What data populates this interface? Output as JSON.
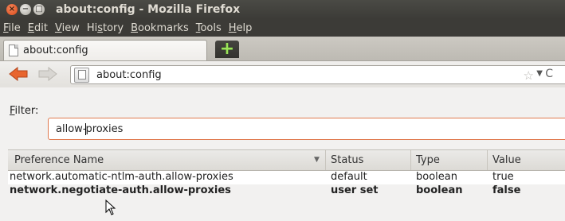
{
  "window": {
    "title": "about:config - Mozilla Firefox",
    "buttons": [
      "×",
      "−",
      "□"
    ]
  },
  "menubar": {
    "items": [
      {
        "mnemonic": "F",
        "rest": "ile"
      },
      {
        "mnemonic": "E",
        "rest": "dit"
      },
      {
        "mnemonic": "V",
        "rest": "iew"
      },
      {
        "pre": "Hi",
        "mnemonic": "s",
        "rest": "tory"
      },
      {
        "mnemonic": "B",
        "rest": "ookmarks"
      },
      {
        "mnemonic": "T",
        "rest": "ools"
      },
      {
        "mnemonic": "H",
        "rest": "elp"
      }
    ]
  },
  "tabs": [
    {
      "label": "about:config"
    }
  ],
  "newtab": {
    "label": "+"
  },
  "navbar": {
    "url": "about:config",
    "star": "☆",
    "dropdown": "▼",
    "reload": "C"
  },
  "filter": {
    "label_mnemonic": "F",
    "label_rest": "ilter:",
    "value_before_caret": "allow-",
    "value_after_caret": "proxies"
  },
  "table": {
    "columns": [
      "Preference Name",
      "Status",
      "Type",
      "Value"
    ],
    "sort_icon": "▼",
    "rows": [
      {
        "name": "network.automatic-ntlm-auth.allow-proxies",
        "status": "default",
        "type": "boolean",
        "value": "true",
        "modified": false
      },
      {
        "name": "network.negotiate-auth.allow-proxies",
        "status": "user set",
        "type": "boolean",
        "value": "false",
        "modified": true
      }
    ]
  },
  "colors": {
    "titlebar": "#3c3b37",
    "close_button": "#e05a2b",
    "filter_focus": "#e07a4f",
    "newtab_plus": "#9be35a",
    "back_arrow": "#e8652e"
  }
}
